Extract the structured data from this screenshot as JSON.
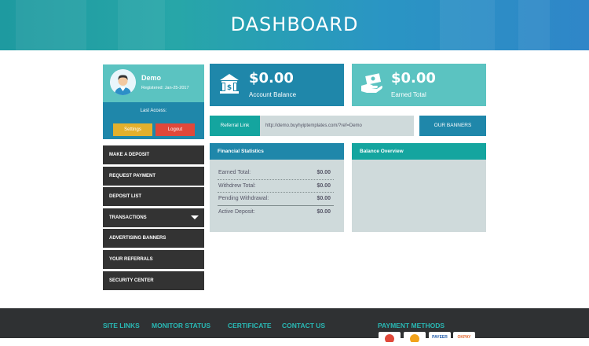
{
  "header": {
    "title": "DASHBOARD"
  },
  "user": {
    "name": "Demo",
    "registered": "Registered: Jan-25-2017",
    "last_access_label": "Last Access:",
    "settings_label": "Settings",
    "logout_label": "Logout"
  },
  "menu": [
    {
      "label": "MAKE A DEPOSIT"
    },
    {
      "label": "REQUEST PAYMENT"
    },
    {
      "label": "DEPOSIT LIST"
    },
    {
      "label": "TRANSACTIONS"
    },
    {
      "label": "ADVERTISING BANNERS"
    },
    {
      "label": "YOUR REFERRALS"
    },
    {
      "label": "SECURITY CENTER"
    }
  ],
  "cards": {
    "account_balance": {
      "value": "$0.00",
      "label": "Account Balance",
      "icon": "bank-icon"
    },
    "earned_total": {
      "value": "$0.00",
      "label": "Earned Total",
      "icon": "cash-hand-icon"
    }
  },
  "referral": {
    "label": "Referral Link",
    "value": "http://demo.buyhyiptemplates.com/?ref=Demo",
    "banners_label": "OUR BANNERS"
  },
  "financial": {
    "title": "Financial Statistics",
    "rows": [
      {
        "label": "Earned Total:",
        "value": "$0.00"
      },
      {
        "label": "Withdrew Total:",
        "value": "$0.00"
      },
      {
        "label": "Pending Withdrawal:",
        "value": "$0.00"
      },
      {
        "label": "Active Deposit:",
        "value": "$0.00"
      }
    ]
  },
  "balance_overview": {
    "title": "Balance Overview"
  },
  "footer": {
    "links": [
      "SITE LINKS",
      "MONITOR STATUS",
      "CERTIFICATE",
      "CONTACT US"
    ],
    "payment_title": "PAYMENT METHODS",
    "payment_icons": [
      "perfectmoney-icon",
      "bitcoin-icon",
      "payeer-icon",
      "okpay-icon"
    ],
    "payment_labels": [
      "PAYEER",
      "OKPAY"
    ]
  },
  "colors": {
    "primary": "#1f87aa",
    "teal": "#5bc3c1",
    "dark": "#333333",
    "footer": "#2f3133",
    "accent_text": "#29b8b4",
    "settings": "#e2b02d",
    "logout": "#e0483a"
  }
}
